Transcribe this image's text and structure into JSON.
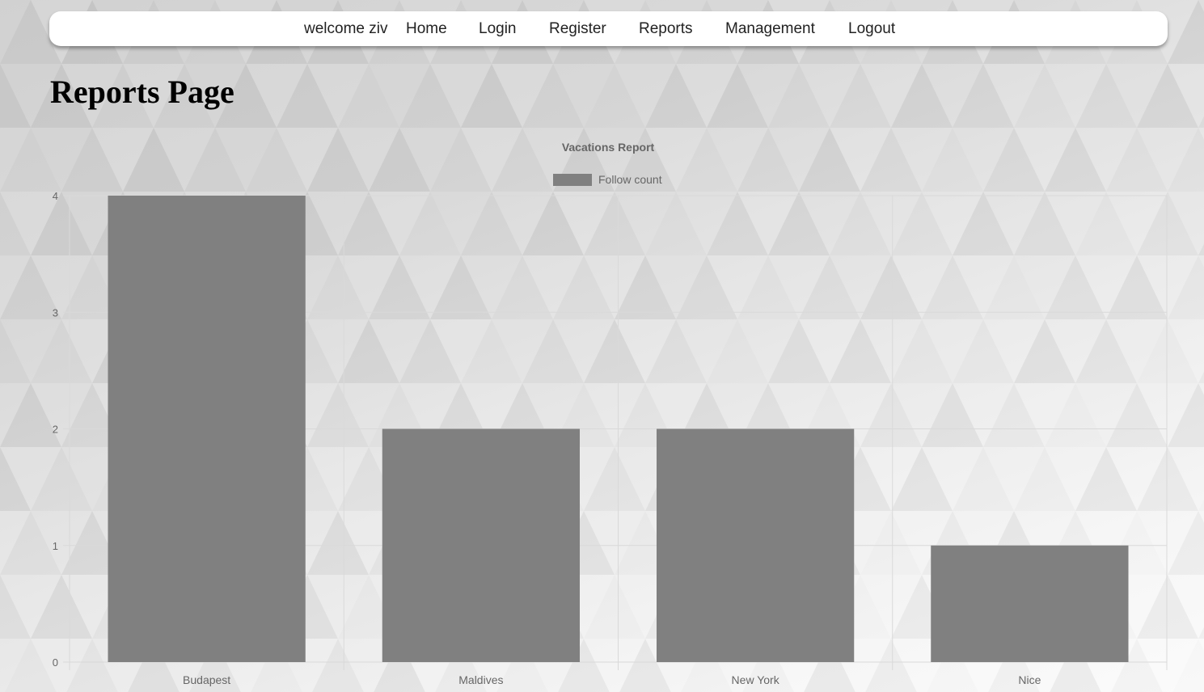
{
  "navbar": {
    "welcome": "welcome ziv",
    "links": [
      "Home",
      "Login",
      "Register",
      "Reports",
      "Management",
      "Logout"
    ]
  },
  "page_title": "Reports Page",
  "colors": {
    "bar": "#808080",
    "grid": "#d9d9d9",
    "text": "#666666"
  },
  "chart_data": {
    "type": "bar",
    "title": "Vacations Report",
    "categories": [
      "Budapest",
      "Maldives",
      "New York",
      "Nice"
    ],
    "series": [
      {
        "name": "Follow count",
        "values": [
          4,
          2,
          2,
          1
        ]
      }
    ],
    "ylim": [
      0,
      4
    ],
    "yticks": [
      0,
      1,
      2,
      3,
      4
    ],
    "xlabel": "",
    "ylabel": "",
    "grid": true,
    "legend": "top-center"
  }
}
